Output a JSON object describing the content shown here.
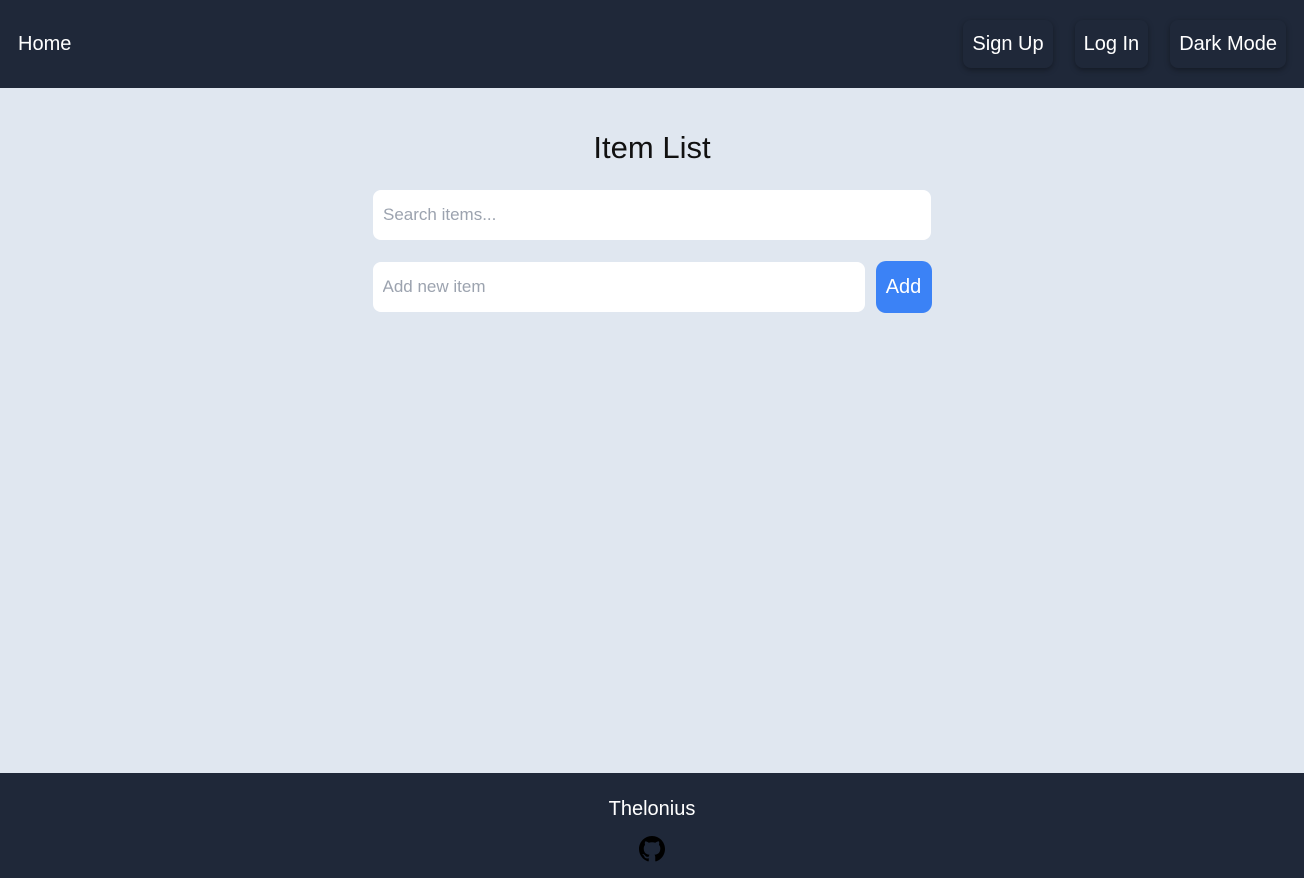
{
  "navbar": {
    "home_label": "Home",
    "buttons": [
      {
        "label": "Sign Up"
      },
      {
        "label": "Log In"
      },
      {
        "label": "Dark Mode"
      }
    ]
  },
  "main": {
    "title": "Item List",
    "search": {
      "value": "",
      "placeholder": "Search items..."
    },
    "add_item": {
      "value": "",
      "placeholder": "Add new item",
      "button_label": "Add"
    },
    "items": []
  },
  "footer": {
    "name": "Thelonius",
    "icon": "github-icon"
  },
  "colors": {
    "navbar_bg": "#1f2839",
    "page_bg": "#e0e7f0",
    "accent": "#3b82f6"
  }
}
